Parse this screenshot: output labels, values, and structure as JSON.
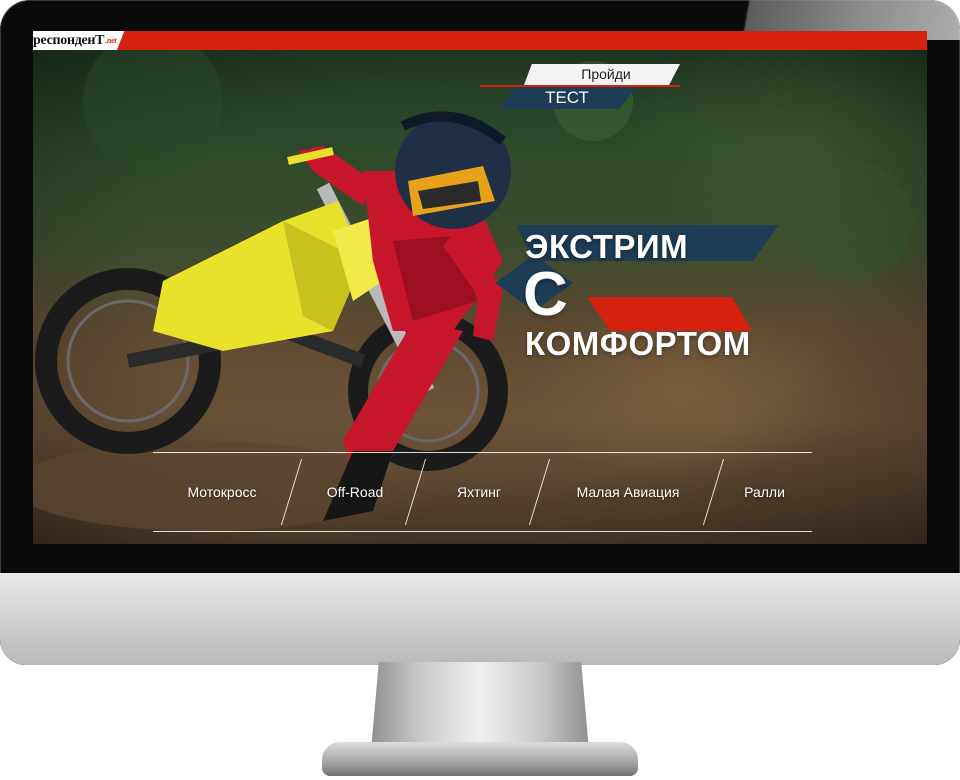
{
  "site": {
    "brand_text": "респонденТ",
    "brand_tld": ".net"
  },
  "promo": {
    "line1": "Пройди",
    "line2": "ТЕСТ"
  },
  "headline": {
    "word1": "ЭКСТРИМ",
    "word2": "С",
    "word3": "КОМФОРТОМ"
  },
  "categories": [
    {
      "label": "Мотокросс"
    },
    {
      "label": "Off-Road"
    },
    {
      "label": "Яхтинг"
    },
    {
      "label": "Малая Авиация"
    },
    {
      "label": "Ралли"
    }
  ],
  "colors": {
    "accent_red": "#d6210f",
    "navy": "#1d3c55",
    "bike_yellow": "#e9e12a"
  },
  "image": {
    "subject": "motocross rider on yellow bike"
  }
}
